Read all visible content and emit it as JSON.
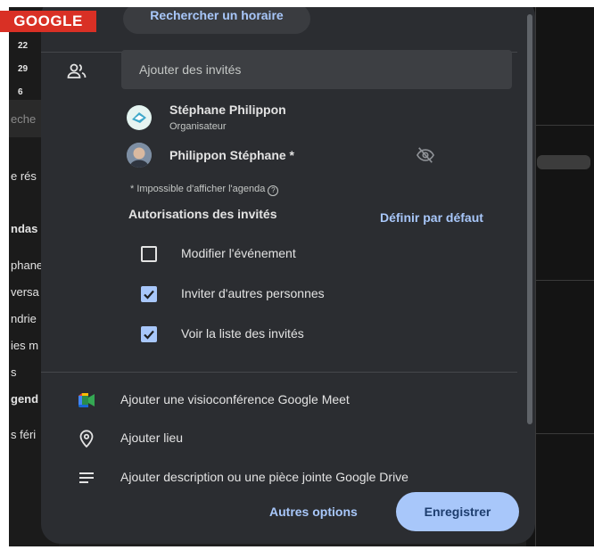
{
  "brand": {
    "label": "GOOGLE",
    "color": "#d93025"
  },
  "background_left": {
    "dates": [
      "22",
      "29",
      "6"
    ],
    "search_placeholder": "eche",
    "fragments": [
      "e rés",
      "ndas",
      "phane",
      "versa",
      "ndrie",
      "ies m",
      "s",
      "gend",
      "s féri"
    ]
  },
  "dialog": {
    "top_button_label": "Rechercher un horaire",
    "guests": {
      "input_placeholder": "Ajouter des invités",
      "list": [
        {
          "name": "Stéphane Philippon",
          "role": "Organisateur"
        },
        {
          "name": "Philippon Stéphane *",
          "role": ""
        }
      ],
      "note": "* Impossible d'afficher l'agenda",
      "help_glyph": "?"
    },
    "permissions": {
      "title": "Autorisations des invités",
      "default_link": "Définir par défaut",
      "items": [
        {
          "label": "Modifier l'événement",
          "checked": false
        },
        {
          "label": "Inviter d'autres personnes",
          "checked": true
        },
        {
          "label": "Voir la liste des invités",
          "checked": true
        }
      ]
    },
    "options": [
      {
        "icon": "google-meet-icon",
        "label": "Ajouter une visioconférence Google Meet"
      },
      {
        "icon": "location-pin-icon",
        "label": "Ajouter lieu"
      },
      {
        "icon": "description-lines-icon",
        "label": "Ajouter description ou une pièce jointe Google Drive"
      }
    ],
    "footer": {
      "more_label": "Autres options",
      "save_label": "Enregistrer"
    }
  },
  "colors": {
    "dialog_bg": "#2b2d31",
    "accent": "#a8c7fa",
    "text": "#e3e3e3"
  }
}
